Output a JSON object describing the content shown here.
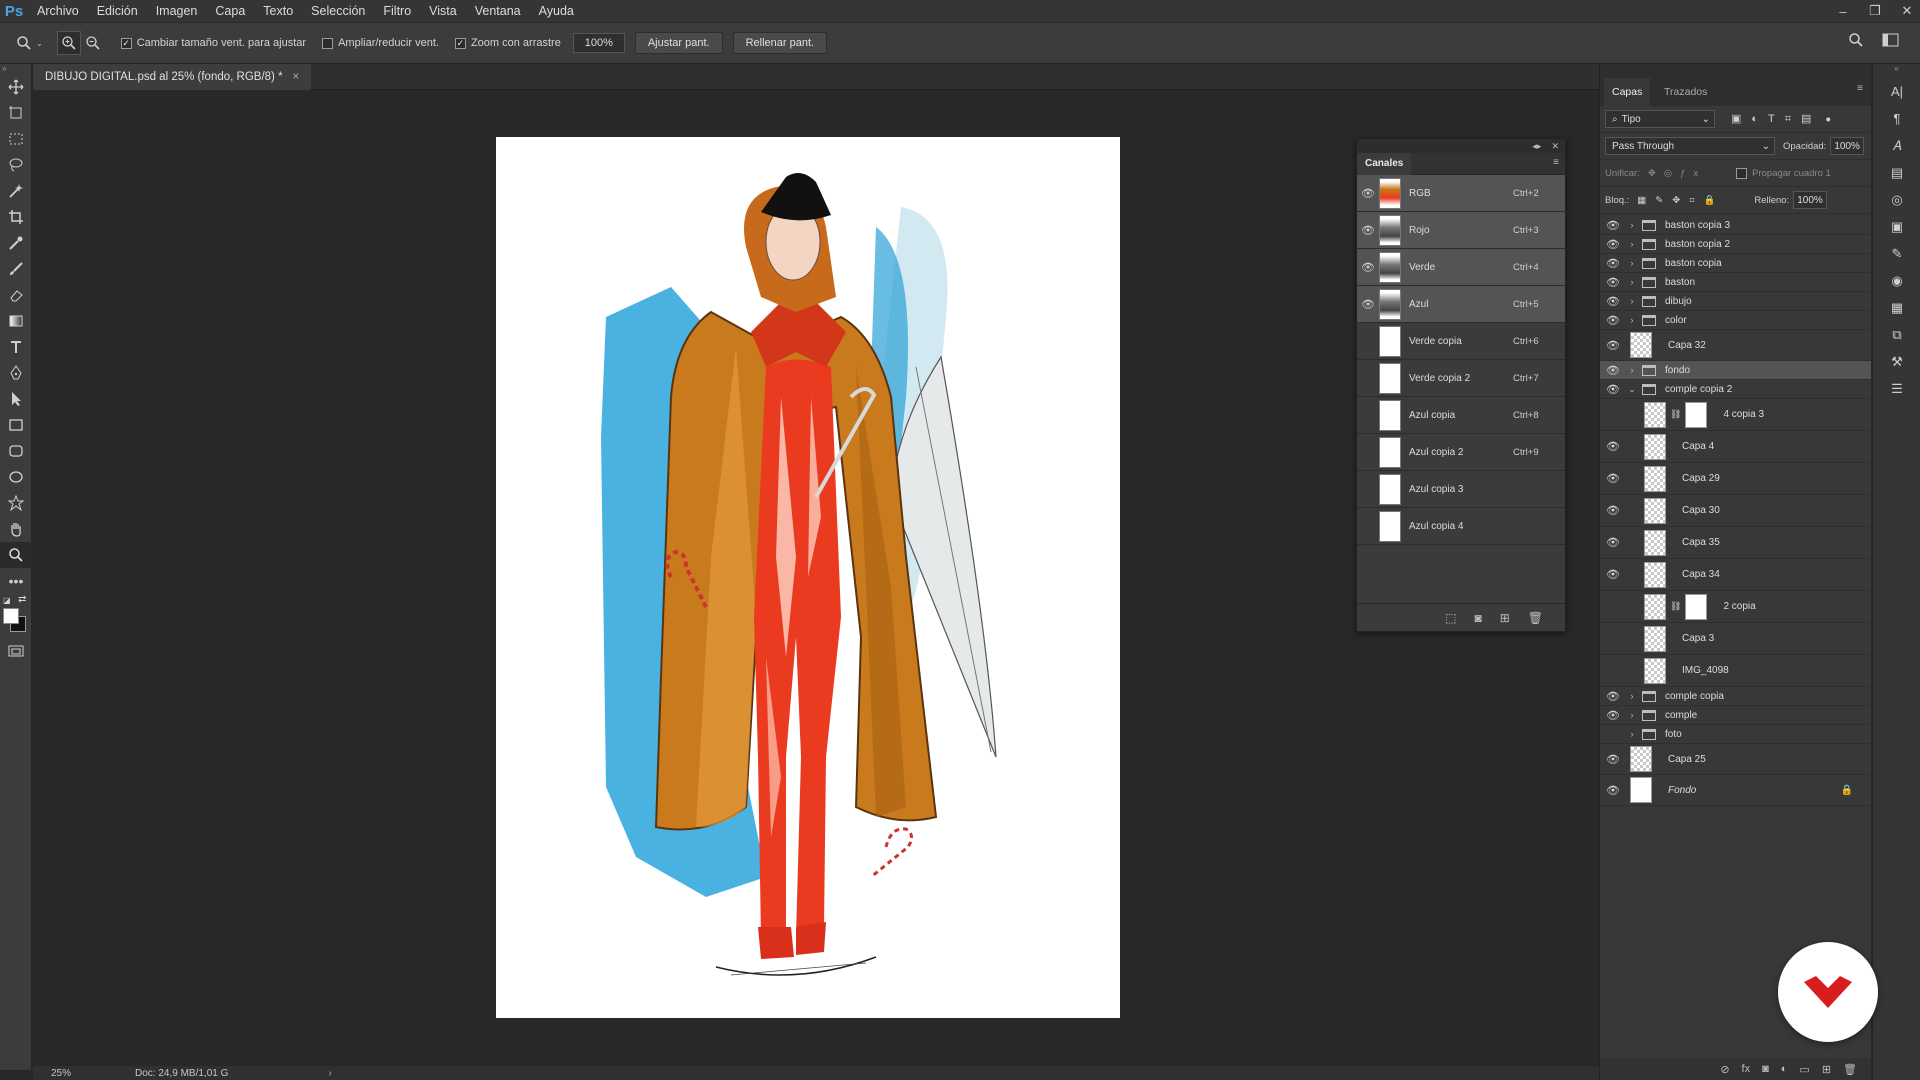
{
  "app": {
    "logo": "Ps"
  },
  "menu": [
    "Archivo",
    "Edición",
    "Imagen",
    "Capa",
    "Texto",
    "Selección",
    "Filtro",
    "Vista",
    "Ventana",
    "Ayuda"
  ],
  "options": {
    "resize_windows": "Cambiar tamaño vent. para ajustar",
    "resize_windows_checked": true,
    "zoom_all_windows": "Ampliar/reducir vent.",
    "zoom_all_windows_checked": false,
    "scrubby_zoom": "Zoom con arrastre",
    "scrubby_zoom_checked": true,
    "zoom_value": "100%",
    "fit_screen": "Ajustar pant.",
    "fill_screen": "Rellenar pant."
  },
  "document": {
    "tab_title": "DIBUJO DIGITAL.psd al 25% (fondo, RGB/8) *",
    "close_glyph": "×"
  },
  "status": {
    "zoom": "25%",
    "doc_info": "Doc: 24,9 MB/1,01 G"
  },
  "channels": {
    "title": "Canales",
    "rows": [
      {
        "name": "RGB",
        "key": "Ctrl+2",
        "visible": true,
        "selected": true
      },
      {
        "name": "Rojo",
        "key": "Ctrl+3",
        "visible": true,
        "selected": true
      },
      {
        "name": "Verde",
        "key": "Ctrl+4",
        "visible": true,
        "selected": true
      },
      {
        "name": "Azul",
        "key": "Ctrl+5",
        "visible": true,
        "selected": true
      },
      {
        "name": "Verde copia",
        "key": "Ctrl+6",
        "visible": false,
        "selected": false
      },
      {
        "name": "Verde copia 2",
        "key": "Ctrl+7",
        "visible": false,
        "selected": false
      },
      {
        "name": "Azul copia",
        "key": "Ctrl+8",
        "visible": false,
        "selected": false
      },
      {
        "name": "Azul copia 2",
        "key": "Ctrl+9",
        "visible": false,
        "selected": false
      },
      {
        "name": "Azul copia 3",
        "key": "",
        "visible": false,
        "selected": false
      },
      {
        "name": "Azul copia 4",
        "key": "",
        "visible": false,
        "selected": false
      }
    ]
  },
  "layers": {
    "tabs": [
      "Capas",
      "Trazados"
    ],
    "filter": "Tipo",
    "blend_mode": "Pass Through",
    "opacity_label": "Opacidad:",
    "opacity": "100%",
    "unify_label": "Unificar:",
    "propagate_label": "Propagar cuadro 1",
    "lock_label": "Bloq.:",
    "fill_label": "Relleno:",
    "fill": "100%",
    "rows": [
      {
        "name": "baston copia 3",
        "kind": "group",
        "visible": true
      },
      {
        "name": "baston copia 2",
        "kind": "group",
        "visible": true
      },
      {
        "name": "baston copia",
        "kind": "group",
        "visible": true
      },
      {
        "name": "baston",
        "kind": "group",
        "visible": true
      },
      {
        "name": "dibujo",
        "kind": "group",
        "visible": true
      },
      {
        "name": "color",
        "kind": "group",
        "visible": true
      },
      {
        "name": "Capa 32",
        "kind": "layer",
        "visible": true
      },
      {
        "name": "fondo",
        "kind": "group",
        "visible": true,
        "selected": true
      },
      {
        "name": "comple copia 2",
        "kind": "group-open",
        "visible": true
      },
      {
        "name": "4 copia 3",
        "kind": "masked",
        "visible": false
      },
      {
        "name": "Capa 4",
        "kind": "child",
        "visible": true
      },
      {
        "name": "Capa 29",
        "kind": "child",
        "visible": true
      },
      {
        "name": "Capa 30",
        "kind": "child",
        "visible": true
      },
      {
        "name": "Capa 35",
        "kind": "child",
        "visible": true
      },
      {
        "name": "Capa 34",
        "kind": "child",
        "visible": true
      },
      {
        "name": "2 copia",
        "kind": "masked",
        "visible": false
      },
      {
        "name": "Capa 3",
        "kind": "child",
        "visible": false
      },
      {
        "name": "IMG_4098",
        "kind": "child",
        "visible": false
      },
      {
        "name": "comple copia",
        "kind": "group",
        "visible": true
      },
      {
        "name": "comple",
        "kind": "group",
        "visible": true
      },
      {
        "name": "foto",
        "kind": "group",
        "visible": false
      },
      {
        "name": "Capa 25",
        "kind": "layer",
        "visible": true
      },
      {
        "name": "Fondo",
        "kind": "background",
        "visible": true
      }
    ]
  },
  "colors": {
    "accent": "#4aa4e8",
    "badge": "#d91c1c",
    "panel": "#383838",
    "canvas": "#282828"
  }
}
